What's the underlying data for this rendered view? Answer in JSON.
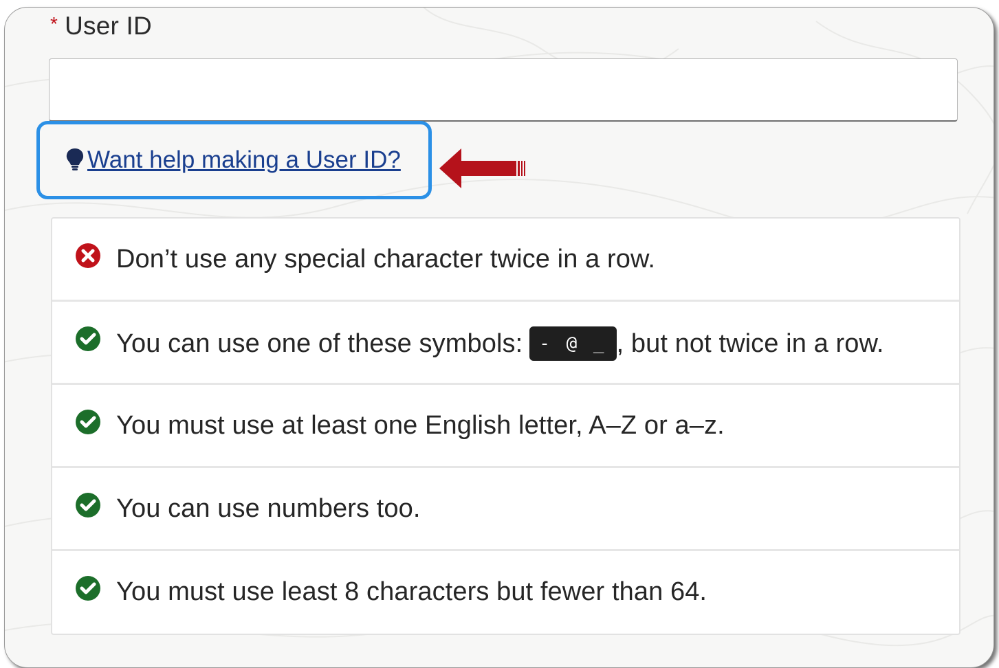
{
  "form": {
    "required_marker": "*",
    "label": "User ID",
    "input_value": "",
    "input_placeholder": ""
  },
  "help": {
    "link_text": "Want help making a User ID?",
    "icon": "lightbulb-icon"
  },
  "annotation": {
    "highlight_color": "#2b90e6",
    "arrow_color": "#b5121b"
  },
  "rules": [
    {
      "status": "error",
      "icon": "circle-x-icon",
      "text": "Don’t use any special character twice in a row."
    },
    {
      "status": "ok",
      "icon": "circle-check-icon",
      "text_before": "You can use one of these symbols:",
      "code": "- @ _",
      "text_after": ", but not twice in a row."
    },
    {
      "status": "ok",
      "icon": "circle-check-icon",
      "text": "You must use at least one English letter, A–Z or a–z."
    },
    {
      "status": "ok",
      "icon": "circle-check-icon",
      "text": "You can use numbers too."
    },
    {
      "status": "ok",
      "icon": "circle-check-icon",
      "text": "You must use least 8 characters but fewer than 64."
    }
  ],
  "colors": {
    "error": "#c0121a",
    "ok": "#1e7a2c",
    "link": "#1a3f8f"
  }
}
